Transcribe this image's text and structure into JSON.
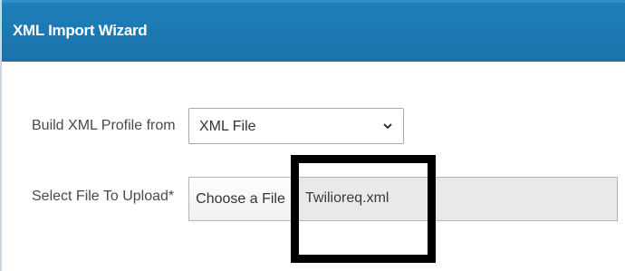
{
  "window": {
    "title": "XML Import Wizard"
  },
  "form": {
    "profile_label": "Build XML Profile from",
    "profile_select": {
      "value": "XML File",
      "icon": "chevron-down-icon"
    },
    "upload_label": "Select File To Upload*",
    "choose_button_label": "Choose a File",
    "selected_file": "Twilioreq.xml"
  },
  "colors": {
    "titlebar": "#1f7fba",
    "highlight_border": "#000000"
  }
}
